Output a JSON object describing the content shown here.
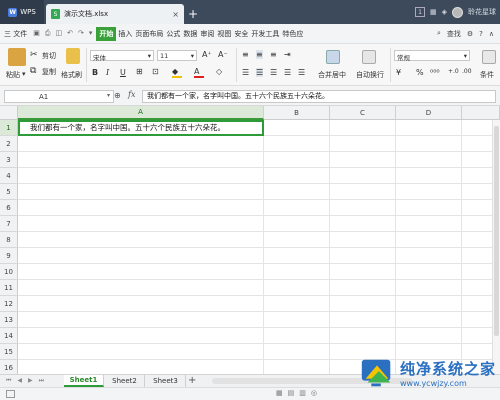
{
  "titlebar": {
    "app_tab": "WPS",
    "doc_tab": "演示文档.xlsx",
    "close": "×",
    "new_tab": "+",
    "badge": "1",
    "user": "聆花星球"
  },
  "menubar": {
    "file": "三 文件",
    "items": [
      "开始",
      "插入",
      "页面布局",
      "公式",
      "数据",
      "审阅",
      "视图",
      "安全",
      "开发工具",
      "特色应"
    ],
    "active_index": 0,
    "search": "查找"
  },
  "ribbon": {
    "paste": "粘贴",
    "cut": "剪切",
    "copy": "复制",
    "format_painter": "格式刷",
    "font_name": "宋体",
    "font_size": "11",
    "bold": "B",
    "italic": "I",
    "underline": "U",
    "merge_center": "合并居中",
    "wrap": "自动换行",
    "number_format": "常规",
    "percent": "%",
    "conditional": "条件"
  },
  "formula": {
    "name_box": "A1",
    "fx": "fx",
    "content": "我们都有一个家，名字叫中国。五十六个民族五十六朵花。"
  },
  "grid": {
    "columns": [
      "A",
      "B",
      "C",
      "D"
    ],
    "rows": [
      "1",
      "2",
      "3",
      "4",
      "5",
      "6",
      "7",
      "8",
      "9",
      "10",
      "11",
      "12",
      "13",
      "14",
      "15",
      "16"
    ],
    "a1": "我们都有一个家，名字叫中国。五十六个民族五十六朵花。"
  },
  "sheets": [
    "Sheet1",
    "Sheet2",
    "Sheet3"
  ],
  "watermark": {
    "title": "纯净系统之家",
    "url": "www.ycwjzy.com"
  },
  "colors": {
    "accent": "#2e9a3a",
    "titlebar": "#3c4a5c"
  }
}
